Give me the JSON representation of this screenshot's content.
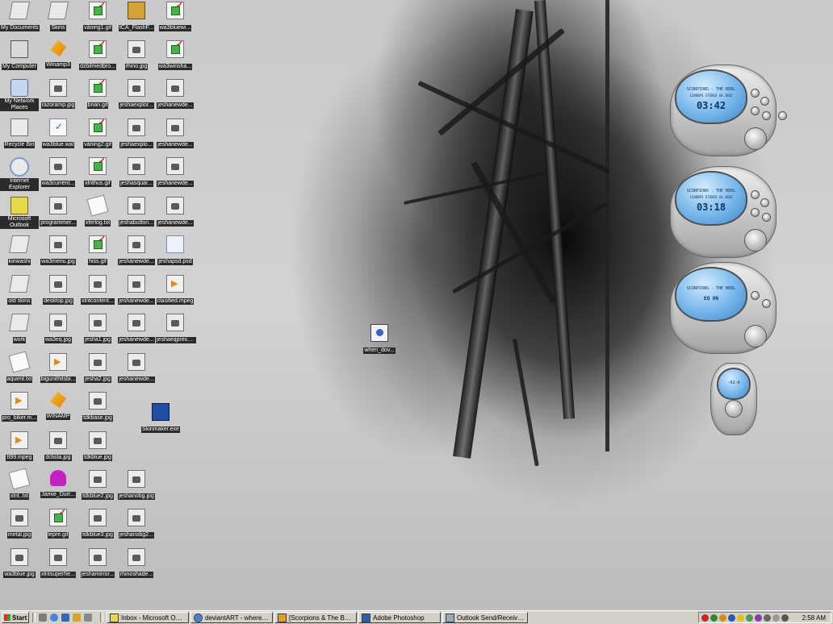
{
  "desktop": {
    "icons": [
      {
        "name": "my-documents",
        "label": "My Documents",
        "kind": "g-folder"
      },
      {
        "name": "my-computer",
        "label": "My Computer",
        "kind": "g-pc"
      },
      {
        "name": "my-network-places",
        "label": "My Network Places",
        "kind": "g-net"
      },
      {
        "name": "recycle-bin",
        "label": "Recycle Bin",
        "kind": "g-bin"
      },
      {
        "name": "internet-explorer",
        "label": "Internet Explorer",
        "kind": "g-ie"
      },
      {
        "name": "microsoft-outlook",
        "label": "Microsoft Outlook",
        "kind": "g-outlook"
      },
      {
        "name": "kinwashi",
        "label": "kinwashi",
        "kind": "g-folder"
      },
      {
        "name": "old-skins",
        "label": "old skins",
        "kind": "g-folder"
      },
      {
        "name": "work",
        "label": "work",
        "kind": "g-folder"
      },
      {
        "name": "aquent-txt",
        "label": "aquent.txt",
        "kind": "g-txt"
      },
      {
        "name": "pro-biker",
        "label": "pro_biker.m...",
        "kind": "g-mpeg"
      },
      {
        "name": "tt99-mpeg",
        "label": "tt99.mpeg",
        "kind": "g-mpeg"
      },
      {
        "name": "xlnt-txt",
        "label": "xlnt..txt",
        "kind": "g-txt"
      },
      {
        "name": "metal-jpg",
        "label": "metal.jpg",
        "kind": "g-img"
      },
      {
        "name": "wa3blue-jpg",
        "label": "wa3blue.jpg",
        "kind": "g-img"
      },
      {
        "name": "skins",
        "label": "Skins",
        "kind": "g-folder"
      },
      {
        "name": "winamp3",
        "label": "Winamp3",
        "kind": "g-winamp"
      },
      {
        "name": "razoramp-jpg",
        "label": "razoramp.jpg",
        "kind": "g-img"
      },
      {
        "name": "wa3blue-wal",
        "label": "wa3blue.wal",
        "kind": "g-wal"
      },
      {
        "name": "wa3current",
        "label": "wa3current...",
        "kind": "g-img"
      },
      {
        "name": "programmer",
        "label": "programmer...",
        "kind": "g-img"
      },
      {
        "name": "wa3menu-jpg",
        "label": "wa3menu.jpg",
        "kind": "g-img"
      },
      {
        "name": "desktop-jpg",
        "label": "desktop.jpg",
        "kind": "g-img"
      },
      {
        "name": "wa3eq-jpg",
        "label": "wa3eq.jpg",
        "kind": "g-img"
      },
      {
        "name": "bigunithits",
        "label": "bigunithitsbi...",
        "kind": "g-mpeg"
      },
      {
        "name": "winamp",
        "label": "WINAMP",
        "kind": "g-winamp"
      },
      {
        "name": "dclista-jpg",
        "label": "dclista.jpg",
        "kind": "g-img"
      },
      {
        "name": "jamie-durr",
        "label": "Jamie_Durr...",
        "kind": "g-hat"
      },
      {
        "name": "lepre-gif",
        "label": "lepre.gif",
        "kind": "g-gif"
      },
      {
        "name": "xlntsuperhe",
        "label": "xlntsuperhe...",
        "kind": "g-img"
      },
      {
        "name": "vaning1-gif",
        "label": "våning1.gif",
        "kind": "g-gif"
      },
      {
        "name": "dzbilmedbro",
        "label": "dzbilmedbro...",
        "kind": "g-gif"
      },
      {
        "name": "brian-gif",
        "label": "brian.gif",
        "kind": "g-gif"
      },
      {
        "name": "vaning2-gif",
        "label": "våning2.gif",
        "kind": "g-gif"
      },
      {
        "name": "xlnthus-gif",
        "label": "xlnthus.gif",
        "kind": "g-gif"
      },
      {
        "name": "xferlog-txt",
        "label": "xferlog.txt",
        "kind": "g-txt"
      },
      {
        "name": "hiss-gif",
        "label": "hiss.gif",
        "kind": "g-gif"
      },
      {
        "name": "xlntcontent",
        "label": "xlntcontent...",
        "kind": "g-img"
      },
      {
        "name": "jesha1-jpg",
        "label": "jesha1.jpg",
        "kind": "g-img"
      },
      {
        "name": "jesha2-jpg",
        "label": "jesha2.jpg",
        "kind": "g-img"
      },
      {
        "name": "tdkbase-jpg",
        "label": "tdkbase.jpg",
        "kind": "g-img"
      },
      {
        "name": "tdkblue-jpg",
        "label": "tdkblue.jpg",
        "kind": "g-img"
      },
      {
        "name": "tdkblue2-jpg",
        "label": "tdkblue2.jpg",
        "kind": "g-img"
      },
      {
        "name": "tdkblue3-jpg",
        "label": "tdkblue3.jpg",
        "kind": "g-img"
      },
      {
        "name": "jeshamirror",
        "label": "jeshamirror...",
        "kind": "g-img"
      },
      {
        "name": "tca-flashf",
        "label": "tCA_FlashF...",
        "kind": "g-flash"
      },
      {
        "name": "rhino-jpg",
        "label": "rhino.jpg",
        "kind": "g-img"
      },
      {
        "name": "jeshaexplor-1",
        "label": "jeshaexplor...",
        "kind": "g-img"
      },
      {
        "name": "jeshaexplo-2",
        "label": "jeshaexplo...",
        "kind": "g-img"
      },
      {
        "name": "jeshasquar",
        "label": "jeshasquar...",
        "kind": "g-img"
      },
      {
        "name": "jeshabutton",
        "label": "jeshabutton...",
        "kind": "g-img"
      },
      {
        "name": "jeshanewde-c4-1",
        "label": "jeshanewde...",
        "kind": "g-img"
      },
      {
        "name": "jeshanewde-c4-2",
        "label": "jeshanewde...",
        "kind": "g-img"
      },
      {
        "name": "jeshanewde-c4-3",
        "label": "jeshanewde...",
        "kind": "g-img"
      },
      {
        "name": "jeshanewde-c4-4",
        "label": "jeshanewde...",
        "kind": "g-img"
      },
      {
        "name": "skinmaker-exe",
        "label": "Skinmaker.exe",
        "kind": "g-skin"
      },
      {
        "name": "jeshanobg-jpg",
        "label": "jeshanobg.jpg",
        "kind": "g-img"
      },
      {
        "name": "jeshanobg2",
        "label": "jeshanobg2...",
        "kind": "g-img"
      },
      {
        "name": "rhinoshade",
        "label": "rhinoshade...",
        "kind": "g-img"
      },
      {
        "name": "wa3bluewi",
        "label": "wa3bluewi...",
        "kind": "g-gif"
      },
      {
        "name": "wa3winsha",
        "label": "wa3winsha...",
        "kind": "g-gif"
      },
      {
        "name": "jeshanewde-c5-1",
        "label": "jeshanewde...",
        "kind": "g-img"
      },
      {
        "name": "jeshanewde-c5-2",
        "label": "jeshanewde...",
        "kind": "g-img"
      },
      {
        "name": "jeshanewde-c5-3",
        "label": "jeshanewde...",
        "kind": "g-img"
      },
      {
        "name": "jeshanewde-c5-4",
        "label": "jeshanewde...",
        "kind": "g-img"
      },
      {
        "name": "jeshapsd-psd",
        "label": "jeshapsd.psd",
        "kind": "g-psd"
      },
      {
        "name": "clasified-mpeg",
        "label": "clasified.mpeg",
        "kind": "g-mpeg"
      },
      {
        "name": "jeshaeqpresets",
        "label": "jeshaeqpresets.jpg",
        "kind": "g-img"
      },
      {
        "name": "when-dov",
        "label": "when_dov...",
        "kind": "g-video"
      }
    ]
  },
  "players": {
    "p1": {
      "scroll": "SCORPIONS - THE BERL",
      "info": "128KBPS STEREO 44.1KHZ",
      "time": "03:42"
    },
    "p2": {
      "scroll": "SCORPIONS - THE BERL",
      "info": "128KBPS STEREO 44.1KHZ",
      "time": "03:18"
    },
    "p3": {
      "scroll": "SCORPIONS - THE BERL",
      "info": "EQ ON",
      "time": ""
    },
    "p4": {
      "time": "-02:4"
    }
  },
  "taskbar": {
    "start_label": "Start",
    "tasks": [
      {
        "label": "Inbox - Microsoft Outlook",
        "active": false
      },
      {
        "label": "deviantART - where art m...",
        "active": false
      },
      {
        "label": "[Scorpions & The Berlin P...",
        "active": false
      },
      {
        "label": "Adobe Photoshop",
        "active": false
      },
      {
        "label": "Outlook Send/Receive Pr...",
        "active": false
      }
    ],
    "clock": "2:58 AM"
  },
  "colors": {
    "taskbar": "#d4d0c8",
    "player_screen": "#76b6ea"
  }
}
